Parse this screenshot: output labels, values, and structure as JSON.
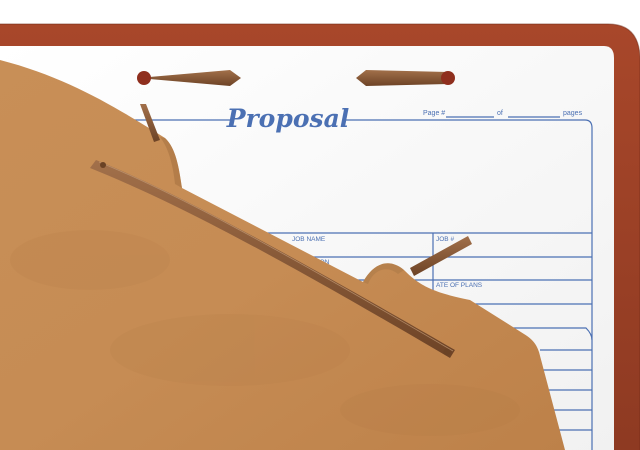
{
  "form": {
    "title": "Proposal",
    "page_label": "Page #",
    "of_label": "of",
    "pages_label": "pages",
    "job_name_label": "JOB NAME",
    "job_number_label": "JOB #",
    "location_label": "ATION",
    "date_of_plans_label": "ATE OF PLANS"
  },
  "colors": {
    "folder_border": "#9b3d24",
    "folder_border_dark": "#7d2f1b",
    "kraft_divider": "#c48a52",
    "kraft_tab": "#caa06e",
    "fastener": "#8a5a34",
    "form_ink": "#4b70b3",
    "paper": "#fdfdfd"
  }
}
